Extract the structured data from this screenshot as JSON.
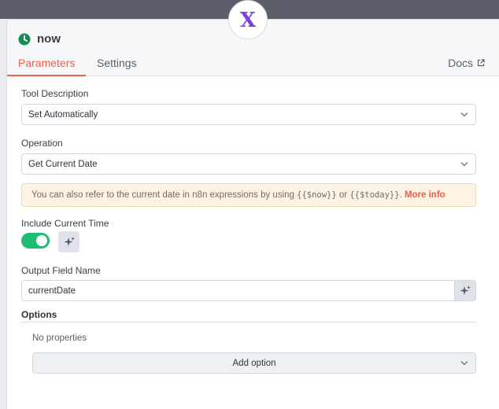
{
  "node": {
    "title": "now",
    "badge_letter": "X"
  },
  "tabs": [
    {
      "label": "Parameters",
      "active": true
    },
    {
      "label": "Settings",
      "active": false
    }
  ],
  "docs_label": "Docs",
  "fields": {
    "tool_description": {
      "label": "Tool Description",
      "value": "Set Automatically"
    },
    "operation": {
      "label": "Operation",
      "value": "Get Current Date"
    },
    "notice": {
      "prefix": "You can also refer to the current date in n8n expressions by using ",
      "code1": "{{$now}}",
      "middle": " or ",
      "code2": "{{$today}}",
      "suffix": ". ",
      "link": "More info"
    },
    "include_current_time": {
      "label": "Include Current Time",
      "enabled": true
    },
    "output_field_name": {
      "label": "Output Field Name",
      "value": "currentDate"
    }
  },
  "options": {
    "title": "Options",
    "empty_text": "No properties",
    "add_label": "Add option"
  },
  "colors": {
    "accent": "#e8614b",
    "toggle_on": "#1dbd76",
    "badge_purple": "#7b3fe4",
    "clock_green": "#1a8a55"
  }
}
